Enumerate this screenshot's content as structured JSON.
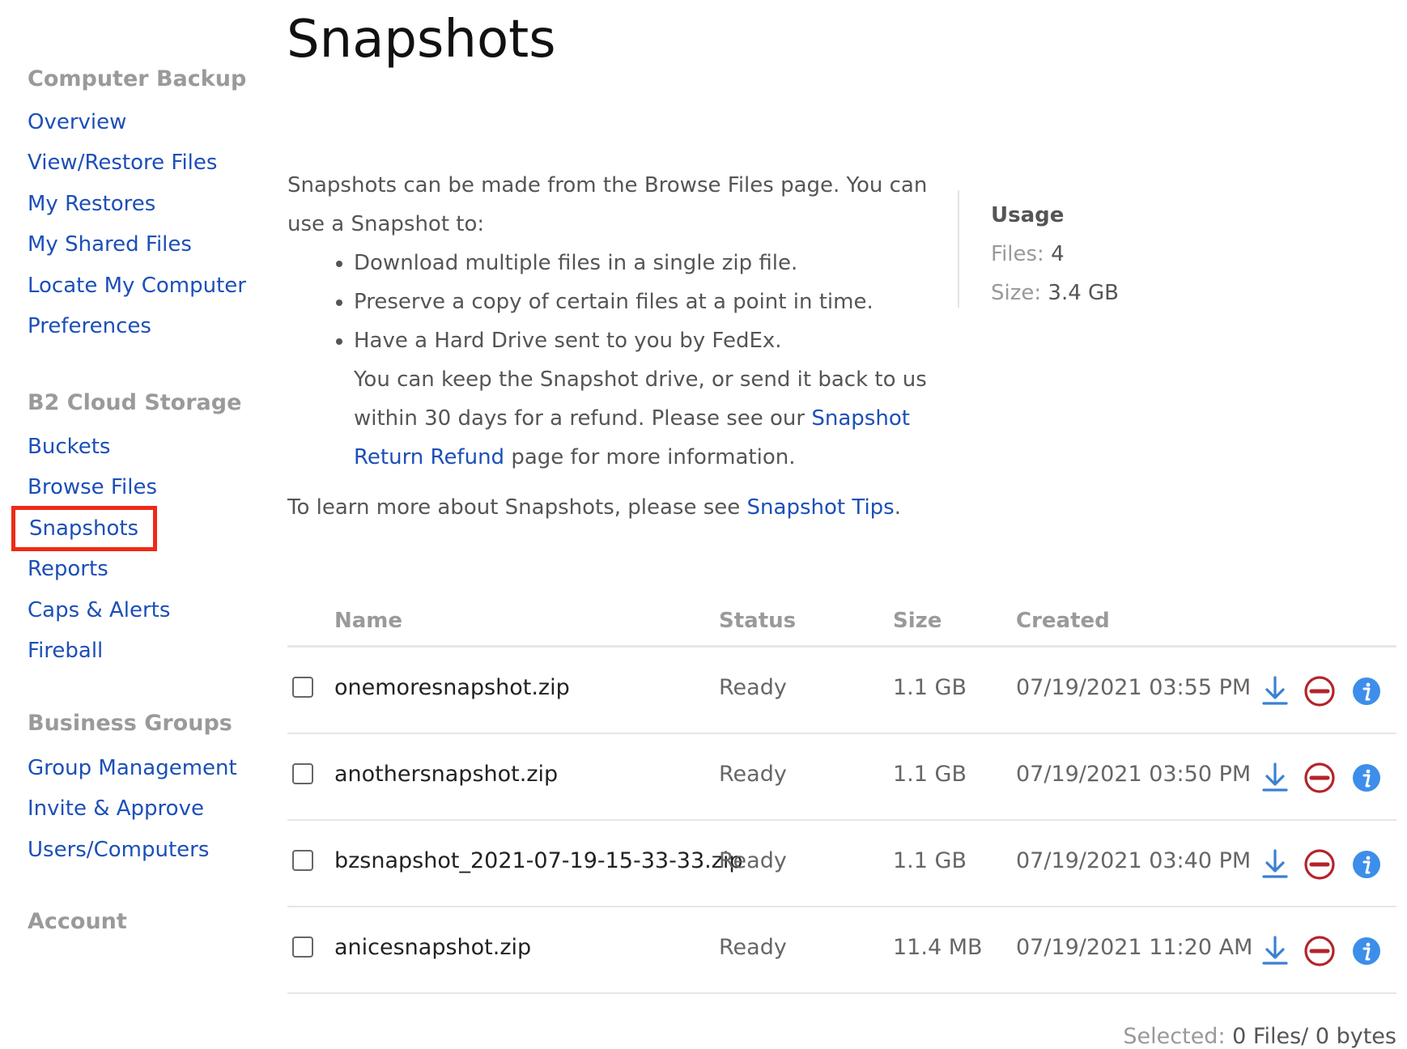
{
  "sidebar": {
    "sections": [
      {
        "heading": "Computer Backup",
        "items": [
          "Overview",
          "View/Restore Files",
          "My Restores",
          "My Shared Files",
          "Locate My Computer",
          "Preferences"
        ]
      },
      {
        "heading": "B2 Cloud Storage",
        "items": [
          "Buckets",
          "Browse Files",
          "Snapshots",
          "Reports",
          "Caps & Alerts",
          "Fireball"
        ]
      },
      {
        "heading": "Business Groups",
        "items": [
          "Group Management",
          "Invite & Approve",
          "Users/Computers"
        ]
      },
      {
        "heading": "Account",
        "items": []
      }
    ],
    "selected_item": "Snapshots"
  },
  "page": {
    "title": "Snapshots",
    "intro_line": "Snapshots can be made from the Browse Files page. You can use a Snapshot to:",
    "bullets": [
      "Download multiple files in a single zip file.",
      "Preserve a copy of certain files at a point in time.",
      "Have a Hard Drive sent to you by FedEx."
    ],
    "bullet3_continued_a": "You can keep the Snapshot drive, or send it back to us within 30 days for a refund. Please see our",
    "bullet3_link": "Snapshot Return Refund",
    "bullet3_continued_b": "page for more information.",
    "learn_prefix": "To learn more about Snapshots, please see",
    "learn_link": "Snapshot Tips",
    "learn_suffix": "."
  },
  "usage": {
    "title": "Usage",
    "files_label": "Files:",
    "files_value": "4",
    "size_label": "Size:",
    "size_value": "3.4 GB"
  },
  "table": {
    "columns": [
      "Name",
      "Status",
      "Size",
      "Created"
    ],
    "rows": [
      {
        "name": "onemoresnapshot.zip",
        "status": "Ready",
        "size": "1.1 GB",
        "created": "07/19/2021 03:55 PM"
      },
      {
        "name": "anothersnapshot.zip",
        "status": "Ready",
        "size": "1.1 GB",
        "created": "07/19/2021 03:50 PM"
      },
      {
        "name": "bzsnapshot_2021-07-19-15-33-33.zip",
        "status": "Ready",
        "size": "1.1 GB",
        "created": "07/19/2021 03:40 PM"
      },
      {
        "name": "anicesnapshot.zip",
        "status": "Ready",
        "size": "11.4 MB",
        "created": "07/19/2021 11:20 AM"
      }
    ],
    "row_actions": [
      "download-icon",
      "delete-icon",
      "info-icon"
    ]
  },
  "selection": {
    "label": "Selected:",
    "files": "0 Files/",
    "bytes": "0 bytes"
  },
  "colors": {
    "link": "#1c4fb8",
    "heading_gray": "#9a9a9a",
    "selected_outline": "#ee2a16",
    "download_icon": "#3b7fd3",
    "delete_icon": "#b3242a",
    "info_icon": "#3d8eea"
  }
}
